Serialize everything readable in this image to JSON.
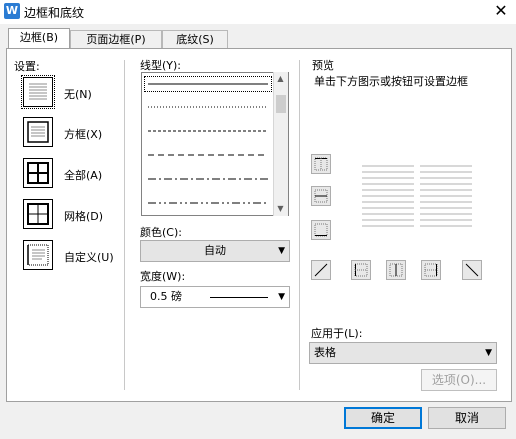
{
  "window": {
    "title": "边框和底纹",
    "close_glyph": "✕",
    "app_icon": "W"
  },
  "tabs": [
    {
      "label": "边框(B)",
      "active": true
    },
    {
      "label": "页面边框(P)",
      "active": false
    },
    {
      "label": "底纹(S)",
      "active": false
    }
  ],
  "settings": {
    "label": "设置:",
    "items": [
      {
        "label": "无(N)",
        "icon": "border-none-icon"
      },
      {
        "label": "方框(X)",
        "icon": "border-box-icon"
      },
      {
        "label": "全部(A)",
        "icon": "border-all-icon"
      },
      {
        "label": "网格(D)",
        "icon": "border-grid-icon"
      },
      {
        "label": "自定义(U)",
        "icon": "border-custom-icon"
      }
    ]
  },
  "style": {
    "line_type_label": "线型(Y):",
    "color_label": "颜色(C):",
    "color_value": "自动",
    "width_label": "宽度(W):",
    "width_value": "0.5  磅"
  },
  "preview": {
    "label": "预览",
    "hint": "单击下方图示或按钮可设置边框",
    "apply_label": "应用于(L):",
    "apply_value": "表格",
    "options_button": "选项(O)..."
  },
  "footer": {
    "ok": "确定",
    "cancel": "取消"
  },
  "colors": {
    "accent": "#0078d7",
    "app_icon_bg": "#2b7cd3"
  }
}
